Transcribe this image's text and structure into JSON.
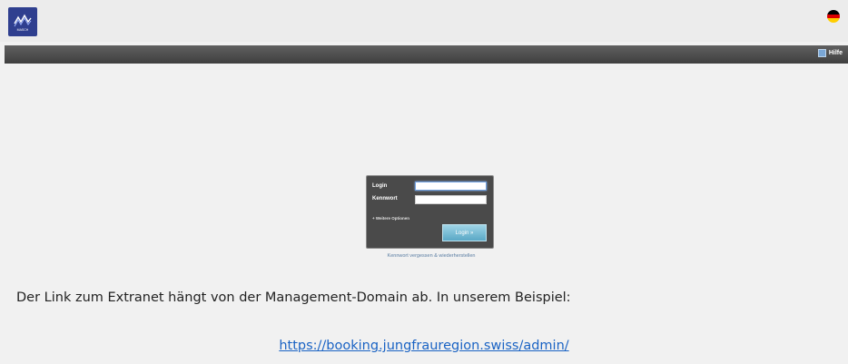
{
  "header": {
    "logo_text": "MASCH",
    "help_label": "Hilfe"
  },
  "login": {
    "login_label": "Login",
    "password_label": "Kennwort",
    "login_value": "",
    "password_value": "",
    "more_options": "+ Weitere Optionen",
    "submit_label": "Login »",
    "forgot_link": "Kennwort vergessen & wiederherstellen"
  },
  "document": {
    "text": "Der Link zum Extranet hängt von der Management-Domain ab. In unserem Beispiel:",
    "link": "https://booking.jungfrauregion.swiss/admin/"
  },
  "colors": {
    "logo_bg": "#2f3f8f",
    "navbar": "#4a4a4a",
    "login_box": "#4a4a4a",
    "button": "#5aa8c6",
    "link": "#1a63c4"
  },
  "icons": {
    "logo": "mountain-logo-icon",
    "language": "german-flag-icon",
    "help": "help-icon"
  }
}
